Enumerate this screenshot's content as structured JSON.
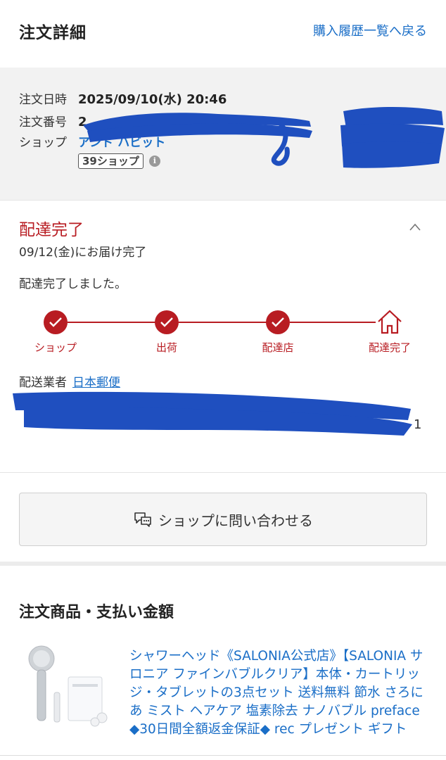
{
  "header": {
    "title": "注文詳細",
    "back_link": "購入履歴一覧へ戻る"
  },
  "order_info": {
    "date_label": "注文日時",
    "date_value": "2025/09/10(水) 20:46",
    "number_label": "注文番号",
    "number_value_visible": "2",
    "shop_label": "ショップ",
    "shop_name": "アンド ハビット",
    "badge": "39ショップ",
    "info_icon_glyph": "i"
  },
  "delivery": {
    "status_title": "配達完了",
    "delivered_date": "09/12(金)にお届け完了",
    "status_message": "配達完了しました。",
    "steps": [
      {
        "label": "ショップ",
        "done": true
      },
      {
        "label": "出荷",
        "done": true
      },
      {
        "label": "配達店",
        "done": true
      },
      {
        "label": "配達完了",
        "done": true
      }
    ],
    "carrier_label": "配送業者",
    "carrier_name": "日本郵便",
    "redacted_trailing_char": "1"
  },
  "contact_button": {
    "label": "ショップに問い合わせる",
    "icon": "chat-bubbles-icon"
  },
  "items_section": {
    "title": "注文商品・支払い金額",
    "product": {
      "name": "シャワーヘッド《SALONIA公式店》【SALONIA サロニア ファインバブルクリア】本体・カートリッジ・タブレットの3点セット 送料無料 節水 さろにあ ミスト ヘアケア 塩素除去 ナノバブル preface ◆30日間全額返金保証◆ rec プレゼント ギフト",
      "image": "shower-head-product-image"
    }
  },
  "colors": {
    "accent_red": "#b81c22",
    "link_blue": "#1a6ec7",
    "info_bg": "#f2f2f2",
    "redaction_blue": "#1f4fbf"
  }
}
